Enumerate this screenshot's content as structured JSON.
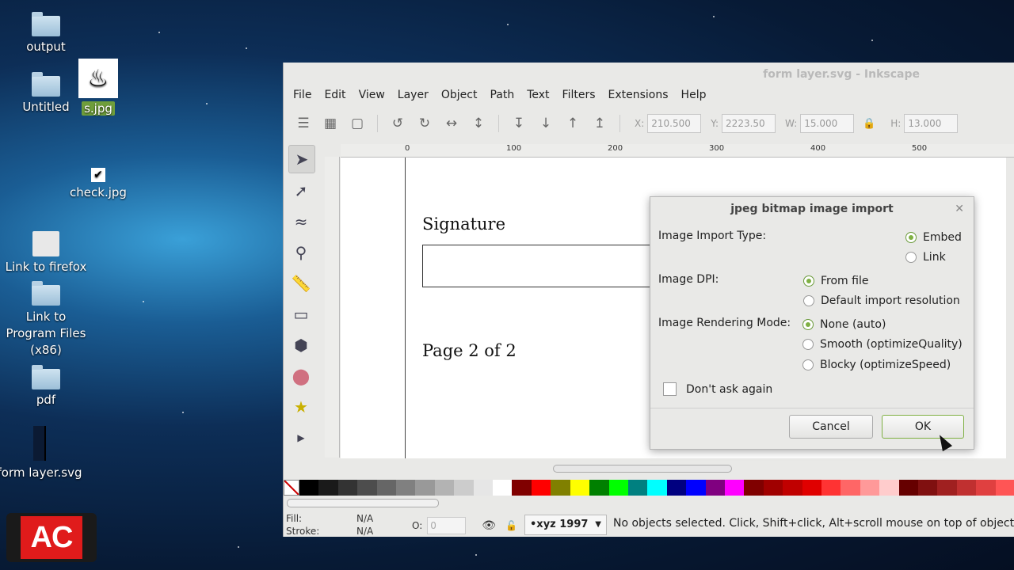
{
  "desktop": {
    "icons": [
      {
        "label": "output"
      },
      {
        "label": "Untitled"
      },
      {
        "label": "s.jpg"
      },
      {
        "label": "check.jpg"
      },
      {
        "label": "Link to firefox"
      },
      {
        "label": "Link to\nProgram Files\n(x86)"
      },
      {
        "label": "pdf"
      },
      {
        "label": "form layer.svg"
      }
    ]
  },
  "window": {
    "title": "form layer.svg - Inkscape",
    "menu": [
      "File",
      "Edit",
      "View",
      "Layer",
      "Object",
      "Path",
      "Text",
      "Filters",
      "Extensions",
      "Help"
    ],
    "toolbar": {
      "x_label": "X:",
      "x_value": "210.500",
      "y_label": "Y:",
      "y_value": "2223.50",
      "w_label": "W:",
      "w_value": "15.000",
      "h_label": "H:",
      "h_value": "13.000"
    },
    "ruler_ticks": [
      "0",
      "100",
      "200",
      "300",
      "400",
      "500"
    ],
    "canvas": {
      "signature_label": "Signature",
      "page_label": "Page 2 of 2"
    },
    "status": {
      "fill_label": "Fill:",
      "stroke_label": "Stroke:",
      "fill_value": "N/A",
      "stroke_value": "N/A",
      "opacity_label": "O:",
      "opacity_value": "0",
      "layer": "•xyz 1997",
      "message": "No objects selected. Click, Shift+click, Alt+scroll mouse on top of objects"
    }
  },
  "dialog": {
    "title": "jpeg bitmap image import",
    "import_type_label": "Image Import Type:",
    "import_type_options": [
      "Embed",
      "Link"
    ],
    "import_type_selected": "Embed",
    "dpi_label": "Image DPI:",
    "dpi_options": [
      "From file",
      "Default import resolution"
    ],
    "dpi_selected": "From file",
    "render_label": "Image Rendering Mode:",
    "render_options": [
      "None (auto)",
      "Smooth (optimizeQuality)",
      "Blocky (optimizeSpeed)"
    ],
    "render_selected": "None (auto)",
    "dont_ask": "Don't ask again",
    "cancel": "Cancel",
    "ok": "OK"
  },
  "logo": {
    "text": "AC"
  },
  "palette_colors": [
    "#000000",
    "#1a1a1a",
    "#333333",
    "#4d4d4d",
    "#666666",
    "#808080",
    "#999999",
    "#b3b3b3",
    "#cccccc",
    "#e6e6e6",
    "#ffffff",
    "#800000",
    "#ff0000",
    "#808000",
    "#ffff00",
    "#008000",
    "#00ff00",
    "#008080",
    "#00ffff",
    "#000080",
    "#0000ff",
    "#800080",
    "#ff00ff",
    "#800000",
    "#a00000",
    "#c00000",
    "#e00000",
    "#ff3333",
    "#ff6666",
    "#ff9999",
    "#ffcccc",
    "#660000",
    "#801010",
    "#a02020",
    "#c03030",
    "#e04040",
    "#ff5555"
  ]
}
